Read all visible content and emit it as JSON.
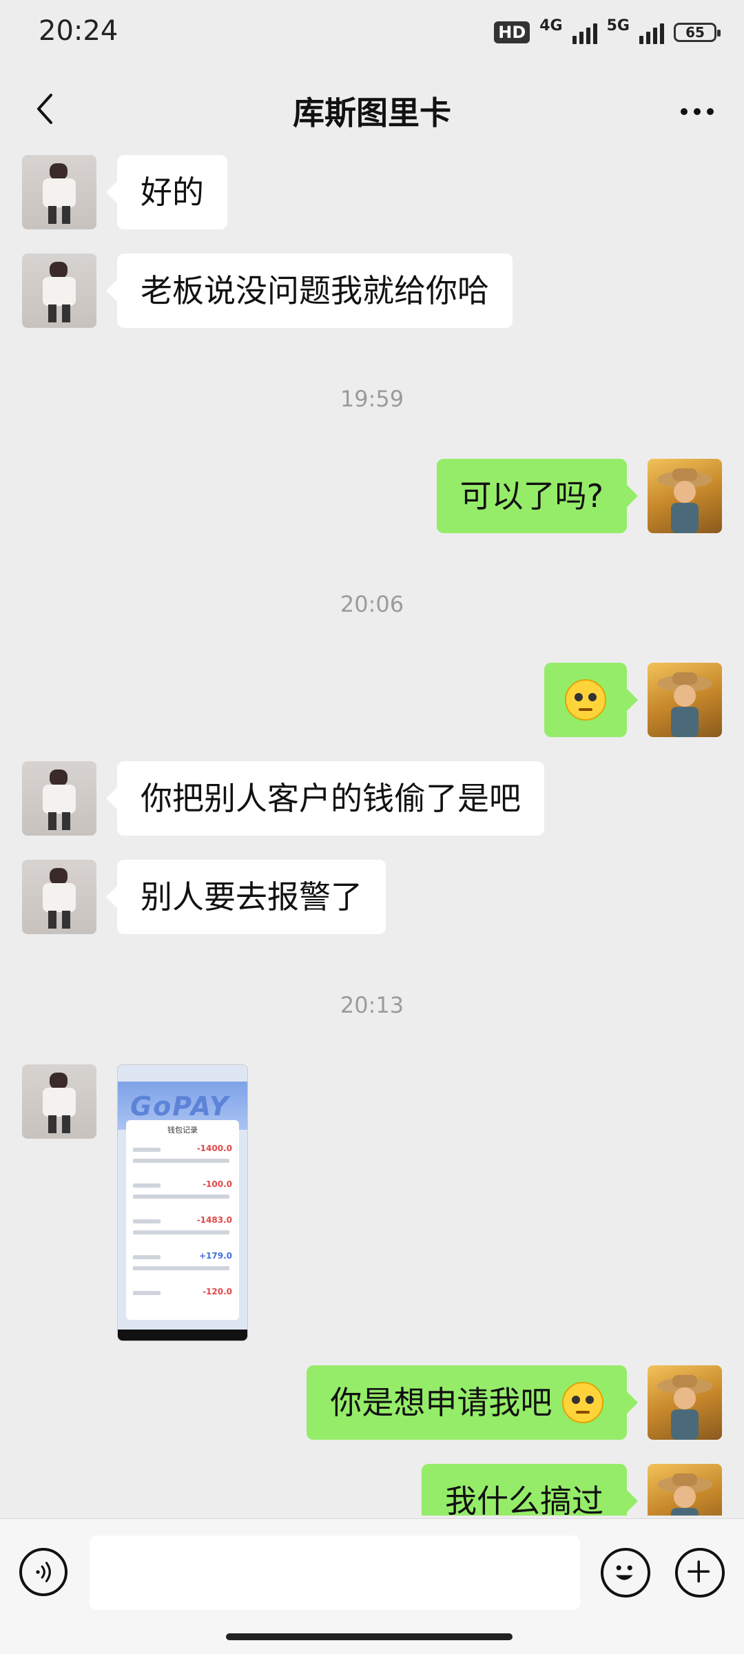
{
  "status_bar": {
    "time": "20:24",
    "hd_label": "HD",
    "network_1": "4G",
    "network_2": "5G",
    "battery": "65"
  },
  "header": {
    "title": "库斯图里卡"
  },
  "messages": [
    {
      "side": "in",
      "text": "好的"
    },
    {
      "side": "in",
      "text": "老板说没问题我就给你哈"
    },
    {
      "timestamp": "19:59"
    },
    {
      "side": "out",
      "text": "可以了吗?"
    },
    {
      "timestamp": "20:06"
    },
    {
      "side": "out",
      "emoji": "confused-face-emoji"
    },
    {
      "side": "in",
      "text": "你把别人客户的钱偷了是吧"
    },
    {
      "side": "in",
      "text": "别人要去报警了"
    },
    {
      "timestamp": "20:13"
    },
    {
      "side": "in",
      "image": {
        "brand": "GoPAY",
        "card_title": "钱包记录",
        "amounts": [
          "-1400.0",
          "-100.0",
          "-1483.0",
          "+179.0",
          "-120.0"
        ]
      }
    },
    {
      "side": "out",
      "text": "你是想申请我吧",
      "emoji": "woozy-face-emoji"
    },
    {
      "side": "out",
      "text": "我什么搞过"
    }
  ],
  "input_bar": {
    "voice_icon": "voice-icon",
    "emoji_icon": "smile-icon",
    "plus_icon": "plus-icon"
  },
  "colors": {
    "background": "#ededed",
    "bubble_out": "#95ec69",
    "bubble_in": "#ffffff",
    "timestamp": "#9b9b9b"
  }
}
